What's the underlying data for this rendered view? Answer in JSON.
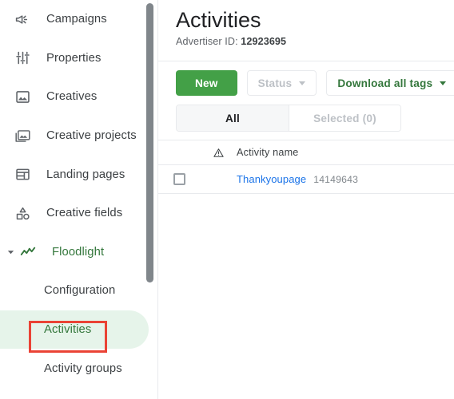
{
  "sidebar": {
    "items": [
      {
        "label": "Campaigns",
        "icon": "campaign-icon",
        "name": "campaigns"
      },
      {
        "label": "Properties",
        "icon": "tune-icon",
        "name": "properties"
      },
      {
        "label": "Creatives",
        "icon": "image-icon",
        "name": "creatives"
      },
      {
        "label": "Creative projects",
        "icon": "photo-library-icon",
        "name": "creative-projects"
      },
      {
        "label": "Landing pages",
        "icon": "web-asset-icon",
        "name": "landing-pages"
      },
      {
        "label": "Creative fields",
        "icon": "shapes-icon",
        "name": "creative-fields"
      }
    ],
    "floodlight": {
      "label": "Floodlight",
      "icon": "timeline-icon",
      "caret": "caret-down-icon",
      "expanded": true,
      "children": [
        {
          "label": "Configuration",
          "selected": false
        },
        {
          "label": "Activities",
          "selected": true
        },
        {
          "label": "Activity groups",
          "selected": false
        }
      ]
    },
    "colors": {
      "active_green": "#34773c",
      "active_bg": "#e6f4ea",
      "icon_gray": "#5f6368"
    }
  },
  "annotation": {
    "shape": "rectangle",
    "target": "Activities",
    "color": "#ea4335"
  },
  "main": {
    "title": "Activities",
    "advertiser_label": "Advertiser ID:",
    "advertiser_id": "12923695",
    "toolbar": {
      "new_label": "New",
      "status_label": "Status",
      "status_disabled": true,
      "download_label": "Download all tags",
      "caret_icon": "caret-down-icon",
      "primary_color": "#43a047",
      "outline_text_color": "#34773c"
    },
    "tabs": [
      {
        "label": "All",
        "selected": true
      },
      {
        "label": "Selected (0)",
        "selected": false
      }
    ],
    "table": {
      "headers": {
        "warning_icon": "warning-triangle-icon",
        "activity_name": "Activity name"
      },
      "rows": [
        {
          "checked": false,
          "name": "Thankyoupage",
          "id": "14149643",
          "link_color": "#1a73e8"
        }
      ]
    }
  }
}
